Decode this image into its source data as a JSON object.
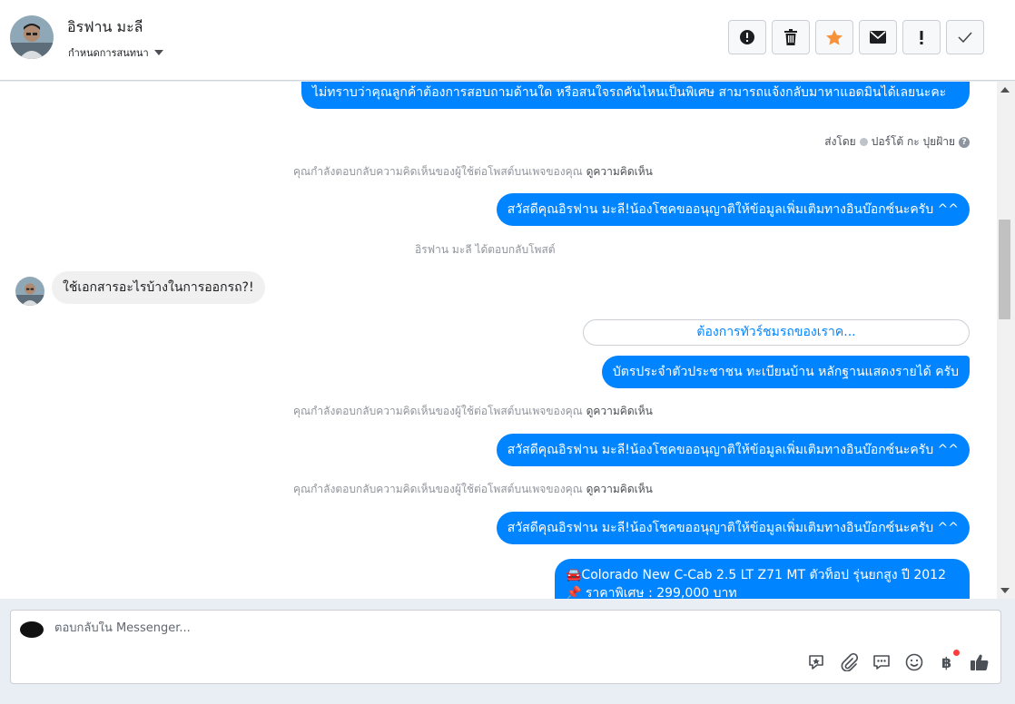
{
  "header": {
    "name": "อิรฟาน มะลี",
    "assign_label": "กำหนดการสนทนา",
    "actions": [
      {
        "icon": "alert-icon"
      },
      {
        "icon": "trash-icon"
      },
      {
        "icon": "star-icon"
      },
      {
        "icon": "envelope-icon"
      },
      {
        "icon": "exclamation-icon"
      },
      {
        "icon": "check-icon"
      }
    ]
  },
  "thread": {
    "msg1": "ไม่ทราบว่าคุณลูกค้าต้องการสอบถามด้านใด หรือสนใจรถคันไหนเป็นพิเศษ สามารถแจ้งกลับมาหาแอดมินได้เลยนะคะ",
    "sent_by_prefix": "ส่งโดย",
    "sent_by_name": "ปอร์โต้ กะ ปุยฝ้าย",
    "comment_notice": "คุณกำลังตอบกลับความคิดเห็นของผู้ใช้ต่อโพสต์บนเพจของคุณ",
    "view_comment": "ดูความคิดเห็น",
    "greeting": "สวัสดีคุณอิรฟาน มะลี!น้องโชคขออนุญาติให้ข้อมูลเพิ่มเติมทางอินบ๊อกซ์นะครับ ^^",
    "user_replied": "อิรฟาน มะลี ได้ตอบกลับโพสต์",
    "user_question": "ใช้เอกสารอะไรบ้างในการออกรถ?!",
    "quick_reply": "ต้องการทัวร์ชมรถของเราค...",
    "docs_answer": "บัตรประจำตัวประชาชน ทะเบียนบ้าน หลักฐานแสดงรายได้ ครับ",
    "car_line1": "🚘Colorado New C-Cab 2.5 LT Z71 MT ตัวท็อป รุ่นยกสูง ปี 2012",
    "car_line2": "📌 ราคาพิเศษ : 299,000 บาท"
  },
  "composer": {
    "placeholder": "ตอบกลับใน Messenger...",
    "tools": [
      "sticker-icon",
      "attachment-icon",
      "saved-replies-icon",
      "emoji-icon",
      "baht-icon",
      "thumbs-up-icon"
    ]
  },
  "colors": {
    "accent": "#0084ff",
    "star": "#f7923a"
  }
}
